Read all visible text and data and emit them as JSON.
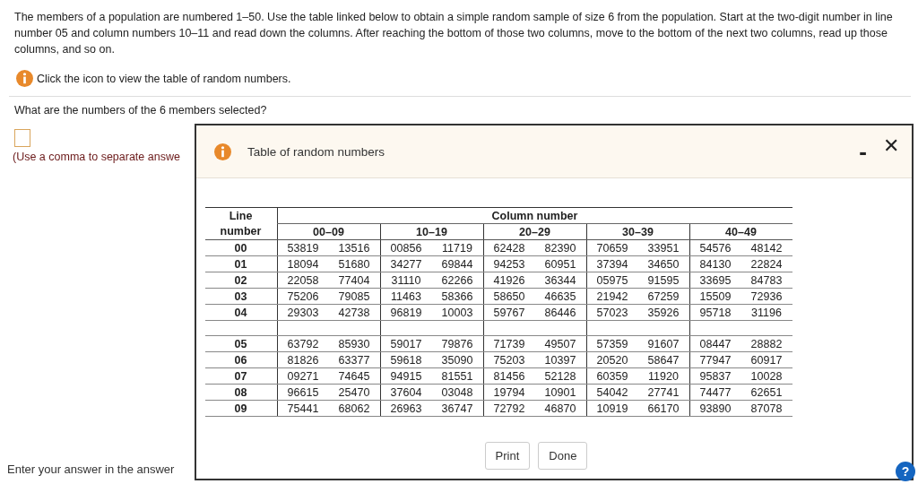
{
  "question": {
    "text": "The members of a population are numbered 1–50. Use the table linked below to obtain a simple random sample of size 6 from the population. Start at the two-digit number in line number 05 and column numbers 10–11 and read down the columns. After reaching the bottom of those two columns, move to the bottom of the next two columns, read up those columns, and so on.",
    "hint": "Click the icon to view the table of random numbers.",
    "prompt": "What are the numbers of the 6 members selected?",
    "answer_note": "(Use a comma to separate answe",
    "footer": "Enter your answer in the answer"
  },
  "help_button": "?",
  "dialog": {
    "title": "Table of random numbers",
    "minimize": "-",
    "close": "✕",
    "table": {
      "line_header": [
        "Line",
        "number"
      ],
      "column_header": "Column number",
      "groups": [
        "00–09",
        "10–19",
        "20–29",
        "30–39",
        "40–49"
      ],
      "blocks": [
        {
          "rows": [
            {
              "line": "00",
              "values": [
                "53819",
                "13516",
                "00856",
                "11719",
                "62428",
                "82390",
                "70659",
                "33951",
                "54576",
                "48142"
              ]
            },
            {
              "line": "01",
              "values": [
                "18094",
                "51680",
                "34277",
                "69844",
                "94253",
                "60951",
                "37394",
                "34650",
                "84130",
                "22824"
              ]
            },
            {
              "line": "02",
              "values": [
                "22058",
                "77404",
                "31110",
                "62266",
                "41926",
                "36344",
                "05975",
                "91595",
                "33695",
                "84783"
              ]
            },
            {
              "line": "03",
              "values": [
                "75206",
                "79085",
                "11463",
                "58366",
                "58650",
                "46635",
                "21942",
                "67259",
                "15509",
                "72936"
              ]
            },
            {
              "line": "04",
              "values": [
                "29303",
                "42738",
                "96819",
                "10003",
                "59767",
                "86446",
                "57023",
                "35926",
                "95718",
                "31196"
              ]
            }
          ]
        },
        {
          "rows": [
            {
              "line": "05",
              "values": [
                "63792",
                "85930",
                "59017",
                "79876",
                "71739",
                "49507",
                "57359",
                "91607",
                "08447",
                "28882"
              ]
            },
            {
              "line": "06",
              "values": [
                "81826",
                "63377",
                "59618",
                "35090",
                "75203",
                "10397",
                "20520",
                "58647",
                "77947",
                "60917"
              ]
            },
            {
              "line": "07",
              "values": [
                "09271",
                "74645",
                "94915",
                "81551",
                "81456",
                "52128",
                "60359",
                "11920",
                "95837",
                "10028"
              ]
            },
            {
              "line": "08",
              "values": [
                "96615",
                "25470",
                "37604",
                "03048",
                "19794",
                "10901",
                "54042",
                "27741",
                "74477",
                "62651"
              ]
            },
            {
              "line": "09",
              "values": [
                "75441",
                "68062",
                "26963",
                "36747",
                "72792",
                "46870",
                "10919",
                "66170",
                "93890",
                "87078"
              ]
            }
          ]
        }
      ]
    },
    "buttons": [
      "Print",
      "Done"
    ]
  }
}
